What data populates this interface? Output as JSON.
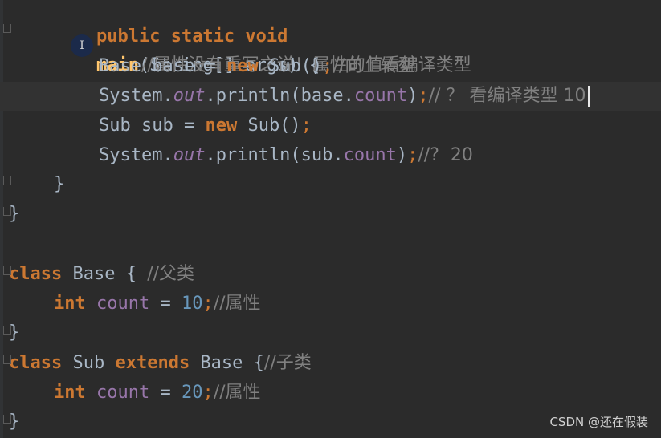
{
  "code": {
    "l1": {
      "indent": "  ",
      "kw": "public static void",
      "fn": "main",
      "rest": "(String[] args) {"
    },
    "l2": {
      "comment": "//属性没有重写之说！属性的值看编译类型"
    },
    "l3": {
      "base": "Base base = ",
      "new": "new",
      "ctor": " Sub()",
      "semi": ";",
      "comment": "//向上转型"
    },
    "l4": {
      "sys": "System.",
      "out": "out",
      "println": ".println(base.",
      "field": "count",
      "close": ")",
      "semi": ";",
      "comment": "// ？ 看编译类型 10"
    },
    "l5": {
      "decl": "Sub sub = ",
      "new": "new",
      "ctor": " Sub()",
      "semi": ";"
    },
    "l6": {
      "sys": "System.",
      "out": "out",
      "println": ".println(sub.",
      "field": "count",
      "close": ")",
      "semi": ";",
      "comment": "//?  20"
    },
    "l7": {
      "brace": "}"
    },
    "l8": {
      "brace": "}"
    },
    "l9": {
      "kw": "class",
      "name": " Base { ",
      "comment": "//父类"
    },
    "l10": {
      "type": "int",
      "field": " count",
      "eq": " = ",
      "num": "10",
      "semi": ";",
      "comment": "//属性"
    },
    "l11": {
      "brace": "}"
    },
    "l12": {
      "kw": "class",
      "name": " Sub ",
      "ext": "extends",
      "base": " Base {",
      "comment": "//子类"
    },
    "l13": {
      "type": "int",
      "field": " count",
      "eq": " = ",
      "num": "20",
      "semi": ";",
      "comment": "//属性"
    },
    "l14": {
      "brace": "}"
    }
  },
  "cursor_icon": "text-cursor-icon",
  "cursor_glyph": "I",
  "watermark": "CSDN @还在假装",
  "colors": {
    "background": "#2b2b2b",
    "keyword": "#cc7832",
    "method": "#ffc66d",
    "field": "#9876aa",
    "number": "#6897bb",
    "comment": "#808080",
    "text": "#a9b7c6"
  }
}
